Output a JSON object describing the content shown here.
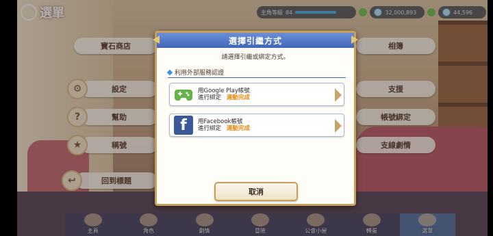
{
  "screen": {
    "title": "選單",
    "status": {
      "rank_label": "主角等級",
      "rank_value": "84",
      "currency_1": "32,000,893",
      "currency_2": "44,596"
    }
  },
  "background_menu": [
    {
      "label": "寶石商店",
      "icon": "shop-icon"
    },
    {
      "label": "設定",
      "icon": "gear-icon"
    },
    {
      "label": "幫助",
      "icon": "help-icon"
    },
    {
      "label": "稱號",
      "icon": "new-title-icon"
    },
    {
      "label": "回到標題",
      "icon": "return-icon"
    },
    {
      "label": "相簿",
      "icon": "album-icon"
    },
    {
      "label": "支援",
      "icon": "support-icon"
    },
    {
      "label": "帳號綁定",
      "icon": "account-link-icon"
    },
    {
      "label": "支線劇情",
      "icon": "side-story-icon"
    }
  ],
  "bottom_nav": [
    {
      "label": "主頁"
    },
    {
      "label": "角色"
    },
    {
      "label": "劇情"
    },
    {
      "label": "冒險"
    },
    {
      "label": "公會小屋"
    },
    {
      "label": "轉蛋"
    },
    {
      "label": "選單"
    }
  ],
  "modal": {
    "title": "選擇引繼方式",
    "subtitle": "請選擇引繼或綁定方式。",
    "section_label": "利用外部服務認證",
    "options": [
      {
        "title": "用Google Play帳號",
        "action": "進行綁定",
        "status": "連動完成",
        "icon": "gamepad-icon"
      },
      {
        "title": "用Facebook帳號",
        "action": "進行綁定",
        "status": "連動完成",
        "icon": "facebook-icon"
      }
    ],
    "cancel_label": "取消"
  },
  "colors": {
    "accent_blue": "#3f65b9",
    "gold_border": "#c8a05a",
    "status_orange": "#e58a12",
    "google_green": "#63b548",
    "facebook_blue": "#3b5998"
  }
}
